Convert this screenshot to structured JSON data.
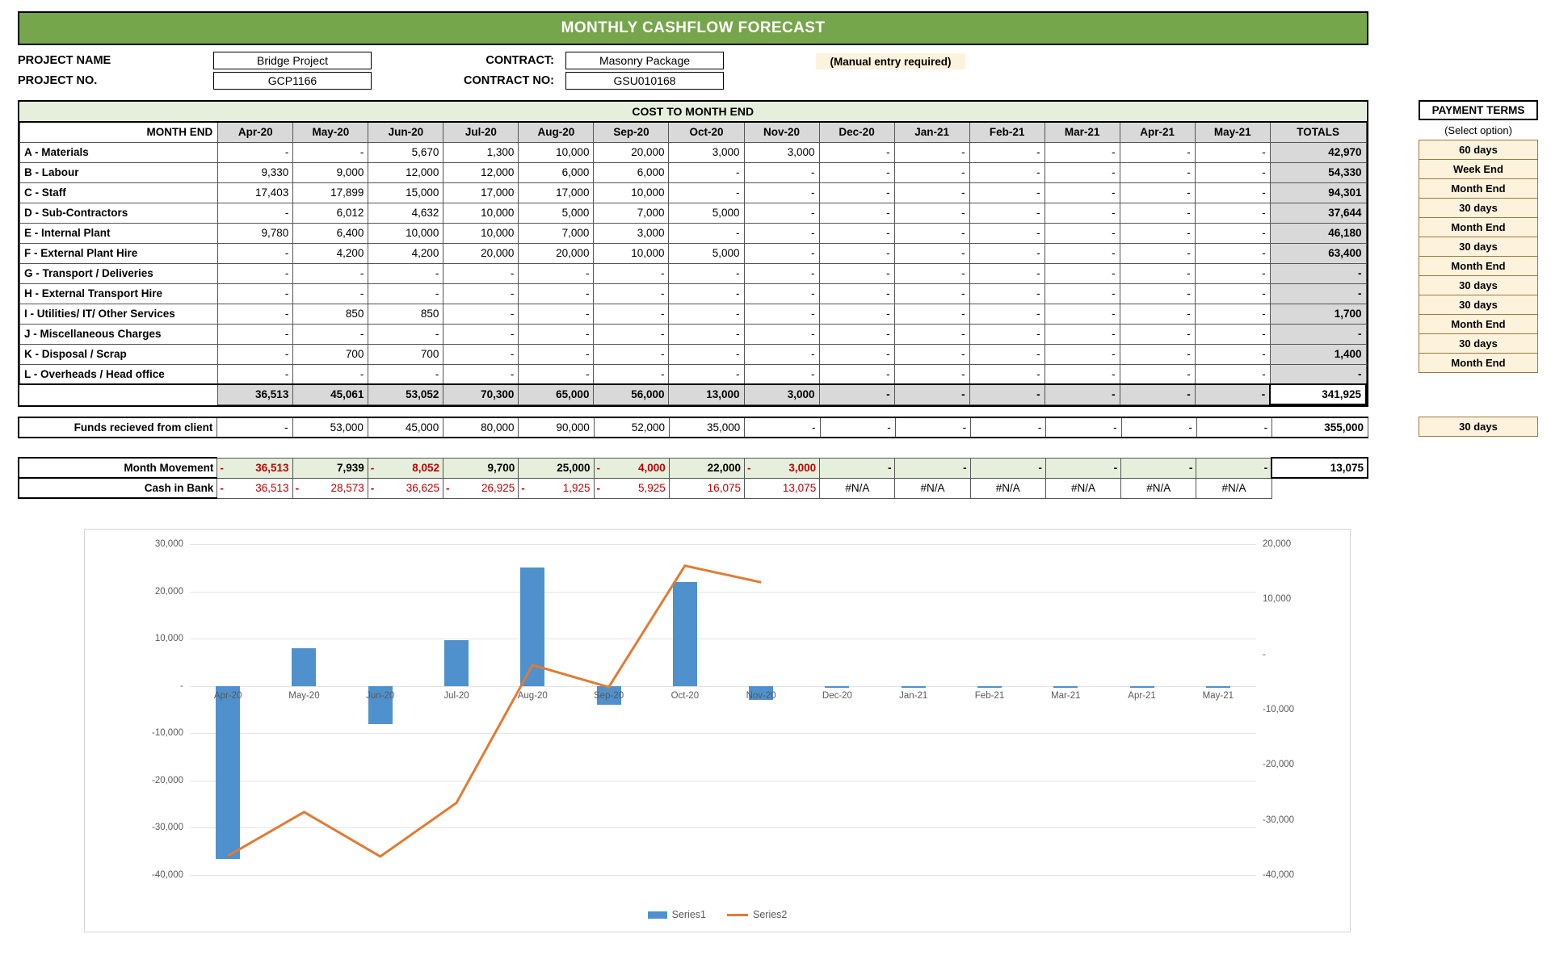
{
  "title": "MONTHLY CASHFLOW FORECAST",
  "project": {
    "name_label": "PROJECT NAME",
    "name_value": "Bridge Project",
    "no_label": "PROJECT NO.",
    "no_value": "GCP1166",
    "contract_label": "CONTRACT:",
    "contract_value": "Masonry Package",
    "contract_no_label": "CONTRACT NO:",
    "contract_no_value": "GSU010168",
    "manual_note": "(Manual entry required)"
  },
  "cost_table": {
    "section_title": "COST TO MONTH END",
    "month_end_label": "MONTH END",
    "totals_label": "TOTALS",
    "months": [
      "Apr-20",
      "May-20",
      "Jun-20",
      "Jul-20",
      "Aug-20",
      "Sep-20",
      "Oct-20",
      "Nov-20",
      "Dec-20",
      "Jan-21",
      "Feb-21",
      "Mar-21",
      "Apr-21",
      "May-21"
    ],
    "rows": [
      {
        "label": "A - Materials",
        "values": [
          "-",
          "-",
          "5,670",
          "1,300",
          "10,000",
          "20,000",
          "3,000",
          "3,000",
          "-",
          "-",
          "-",
          "-",
          "-",
          "-"
        ],
        "total": "42,970"
      },
      {
        "label": "B - Labour",
        "values": [
          "9,330",
          "9,000",
          "12,000",
          "12,000",
          "6,000",
          "6,000",
          "-",
          "-",
          "-",
          "-",
          "-",
          "-",
          "-",
          "-"
        ],
        "total": "54,330"
      },
      {
        "label": "C - Staff",
        "values": [
          "17,403",
          "17,899",
          "15,000",
          "17,000",
          "17,000",
          "10,000",
          "-",
          "-",
          "-",
          "-",
          "-",
          "-",
          "-",
          "-"
        ],
        "total": "94,301"
      },
      {
        "label": "D - Sub-Contractors",
        "values": [
          "-",
          "6,012",
          "4,632",
          "10,000",
          "5,000",
          "7,000",
          "5,000",
          "-",
          "-",
          "-",
          "-",
          "-",
          "-",
          "-"
        ],
        "total": "37,644"
      },
      {
        "label": "E - Internal Plant",
        "values": [
          "9,780",
          "6,400",
          "10,000",
          "10,000",
          "7,000",
          "3,000",
          "-",
          "-",
          "-",
          "-",
          "-",
          "-",
          "-",
          "-"
        ],
        "total": "46,180"
      },
      {
        "label": "F - External Plant Hire",
        "values": [
          "-",
          "4,200",
          "4,200",
          "20,000",
          "20,000",
          "10,000",
          "5,000",
          "-",
          "-",
          "-",
          "-",
          "-",
          "-",
          "-"
        ],
        "total": "63,400"
      },
      {
        "label": "G - Transport / Deliveries",
        "values": [
          "-",
          "-",
          "-",
          "-",
          "-",
          "-",
          "-",
          "-",
          "-",
          "-",
          "-",
          "-",
          "-",
          "-"
        ],
        "total": "-"
      },
      {
        "label": "H - External Transport Hire",
        "values": [
          "-",
          "-",
          "-",
          "-",
          "-",
          "-",
          "-",
          "-",
          "-",
          "-",
          "-",
          "-",
          "-",
          "-"
        ],
        "total": "-"
      },
      {
        "label": "I - Utilities/ IT/ Other Services",
        "values": [
          "-",
          "850",
          "850",
          "-",
          "-",
          "-",
          "-",
          "-",
          "-",
          "-",
          "-",
          "-",
          "-",
          "-"
        ],
        "total": "1,700"
      },
      {
        "label": "J - Miscellaneous Charges",
        "values": [
          "-",
          "-",
          "-",
          "-",
          "-",
          "-",
          "-",
          "-",
          "-",
          "-",
          "-",
          "-",
          "-",
          "-"
        ],
        "total": "-"
      },
      {
        "label": "K - Disposal / Scrap",
        "values": [
          "-",
          "700",
          "700",
          "-",
          "-",
          "-",
          "-",
          "-",
          "-",
          "-",
          "-",
          "-",
          "-",
          "-"
        ],
        "total": "1,400"
      },
      {
        "label": "L - Overheads / Head office",
        "values": [
          "-",
          "-",
          "-",
          "-",
          "-",
          "-",
          "-",
          "-",
          "-",
          "-",
          "-",
          "-",
          "-",
          "-"
        ],
        "total": "-"
      }
    ],
    "summary": {
      "label": "",
      "values": [
        "36,513",
        "45,061",
        "53,052",
        "70,300",
        "65,000",
        "56,000",
        "13,000",
        "3,000",
        "-",
        "-",
        "-",
        "-",
        "-",
        "-"
      ],
      "total": "341,925"
    }
  },
  "funds": {
    "label": "Funds recieved from client",
    "values": [
      "-",
      "53,000",
      "45,000",
      "80,000",
      "90,000",
      "52,000",
      "35,000",
      "-",
      "-",
      "-",
      "-",
      "-",
      "-",
      "-"
    ],
    "total": "355,000"
  },
  "movement": {
    "label": "Month Movement",
    "values": [
      {
        "sign": "-",
        "text": "36,513",
        "negative": true
      },
      {
        "sign": "",
        "text": "7,939",
        "negative": false
      },
      {
        "sign": "-",
        "text": "8,052",
        "negative": true
      },
      {
        "sign": "",
        "text": "9,700",
        "negative": false
      },
      {
        "sign": "",
        "text": "25,000",
        "negative": false
      },
      {
        "sign": "-",
        "text": "4,000",
        "negative": true
      },
      {
        "sign": "",
        "text": "22,000",
        "negative": false
      },
      {
        "sign": "-",
        "text": "3,000",
        "negative": true
      },
      {
        "sign": "",
        "text": "-",
        "negative": false
      },
      {
        "sign": "",
        "text": "-",
        "negative": false
      },
      {
        "sign": "",
        "text": "-",
        "negative": false
      },
      {
        "sign": "",
        "text": "-",
        "negative": false
      },
      {
        "sign": "",
        "text": "-",
        "negative": false
      },
      {
        "sign": "",
        "text": "-",
        "negative": false
      }
    ],
    "total": "13,075"
  },
  "cash_in_bank": {
    "label": "Cash in Bank",
    "values": [
      {
        "sign": "-",
        "text": "36,513",
        "negative": true
      },
      {
        "sign": "-",
        "text": "28,573",
        "negative": true
      },
      {
        "sign": "-",
        "text": "36,625",
        "negative": true
      },
      {
        "sign": "-",
        "text": "26,925",
        "negative": true
      },
      {
        "sign": "-",
        "text": "1,925",
        "negative": true
      },
      {
        "sign": "-",
        "text": "5,925",
        "negative": true
      },
      {
        "sign": "",
        "text": "16,075",
        "negative": false
      },
      {
        "sign": "",
        "text": "13,075",
        "negative": false
      },
      {
        "sign": "",
        "text": "#N/A",
        "negative": false
      },
      {
        "sign": "",
        "text": "#N/A",
        "negative": false
      },
      {
        "sign": "",
        "text": "#N/A",
        "negative": false
      },
      {
        "sign": "",
        "text": "#N/A",
        "negative": false
      },
      {
        "sign": "",
        "text": "#N/A",
        "negative": false
      },
      {
        "sign": "",
        "text": "#N/A",
        "negative": false
      }
    ],
    "total": ""
  },
  "payment_terms": {
    "header": "PAYMENT TERMS",
    "subheader": "(Select option)",
    "options": [
      "60 days",
      "Week End",
      "Month End",
      "30 days",
      "Month End",
      "30 days",
      "Month End",
      "30 days",
      "30 days",
      "Month End",
      "30 days",
      "Month End"
    ],
    "funds_option": "30 days"
  },
  "colors": {
    "banner_green": "#76a64b",
    "series1_blue": "#4f91cd",
    "series2_orange": "#e07b34",
    "negative_red": "#c00000",
    "highlight_cream": "#fdf2dc",
    "section_green": "#e5efdc"
  },
  "chart_data": {
    "type": "bar",
    "title": "",
    "xlabel": "",
    "ylabel": "",
    "grid": true,
    "legend_position": "bottom",
    "categories": [
      "Apr-20",
      "May-20",
      "Jun-20",
      "Jul-20",
      "Aug-20",
      "Sep-20",
      "Oct-20",
      "Nov-20",
      "Dec-20",
      "Jan-21",
      "Feb-21",
      "Mar-21",
      "Apr-21",
      "May-21"
    ],
    "yticks_left": [
      "30,000",
      "20,000",
      "10,000",
      "-",
      "-10,000",
      "-20,000",
      "-30,000",
      "-40,000"
    ],
    "yticks_right": [
      "20,000",
      "10,000",
      "-",
      "-10,000",
      "-20,000",
      "-30,000",
      "-40,000"
    ],
    "ylim_left": [
      -40000,
      30000
    ],
    "ylim_right": [
      -40000,
      20000
    ],
    "series": [
      {
        "name": "Series1",
        "type": "bar",
        "axis": "left",
        "values": [
          -36513,
          7939,
          -8052,
          9700,
          25000,
          -4000,
          22000,
          -3000,
          0,
          0,
          0,
          0,
          0,
          0
        ]
      },
      {
        "name": "Series2",
        "type": "line",
        "axis": "right",
        "values": [
          -36513,
          -28573,
          -36625,
          -26925,
          -1925,
          -5925,
          16075,
          13075,
          null,
          null,
          null,
          null,
          null,
          null
        ]
      }
    ]
  }
}
